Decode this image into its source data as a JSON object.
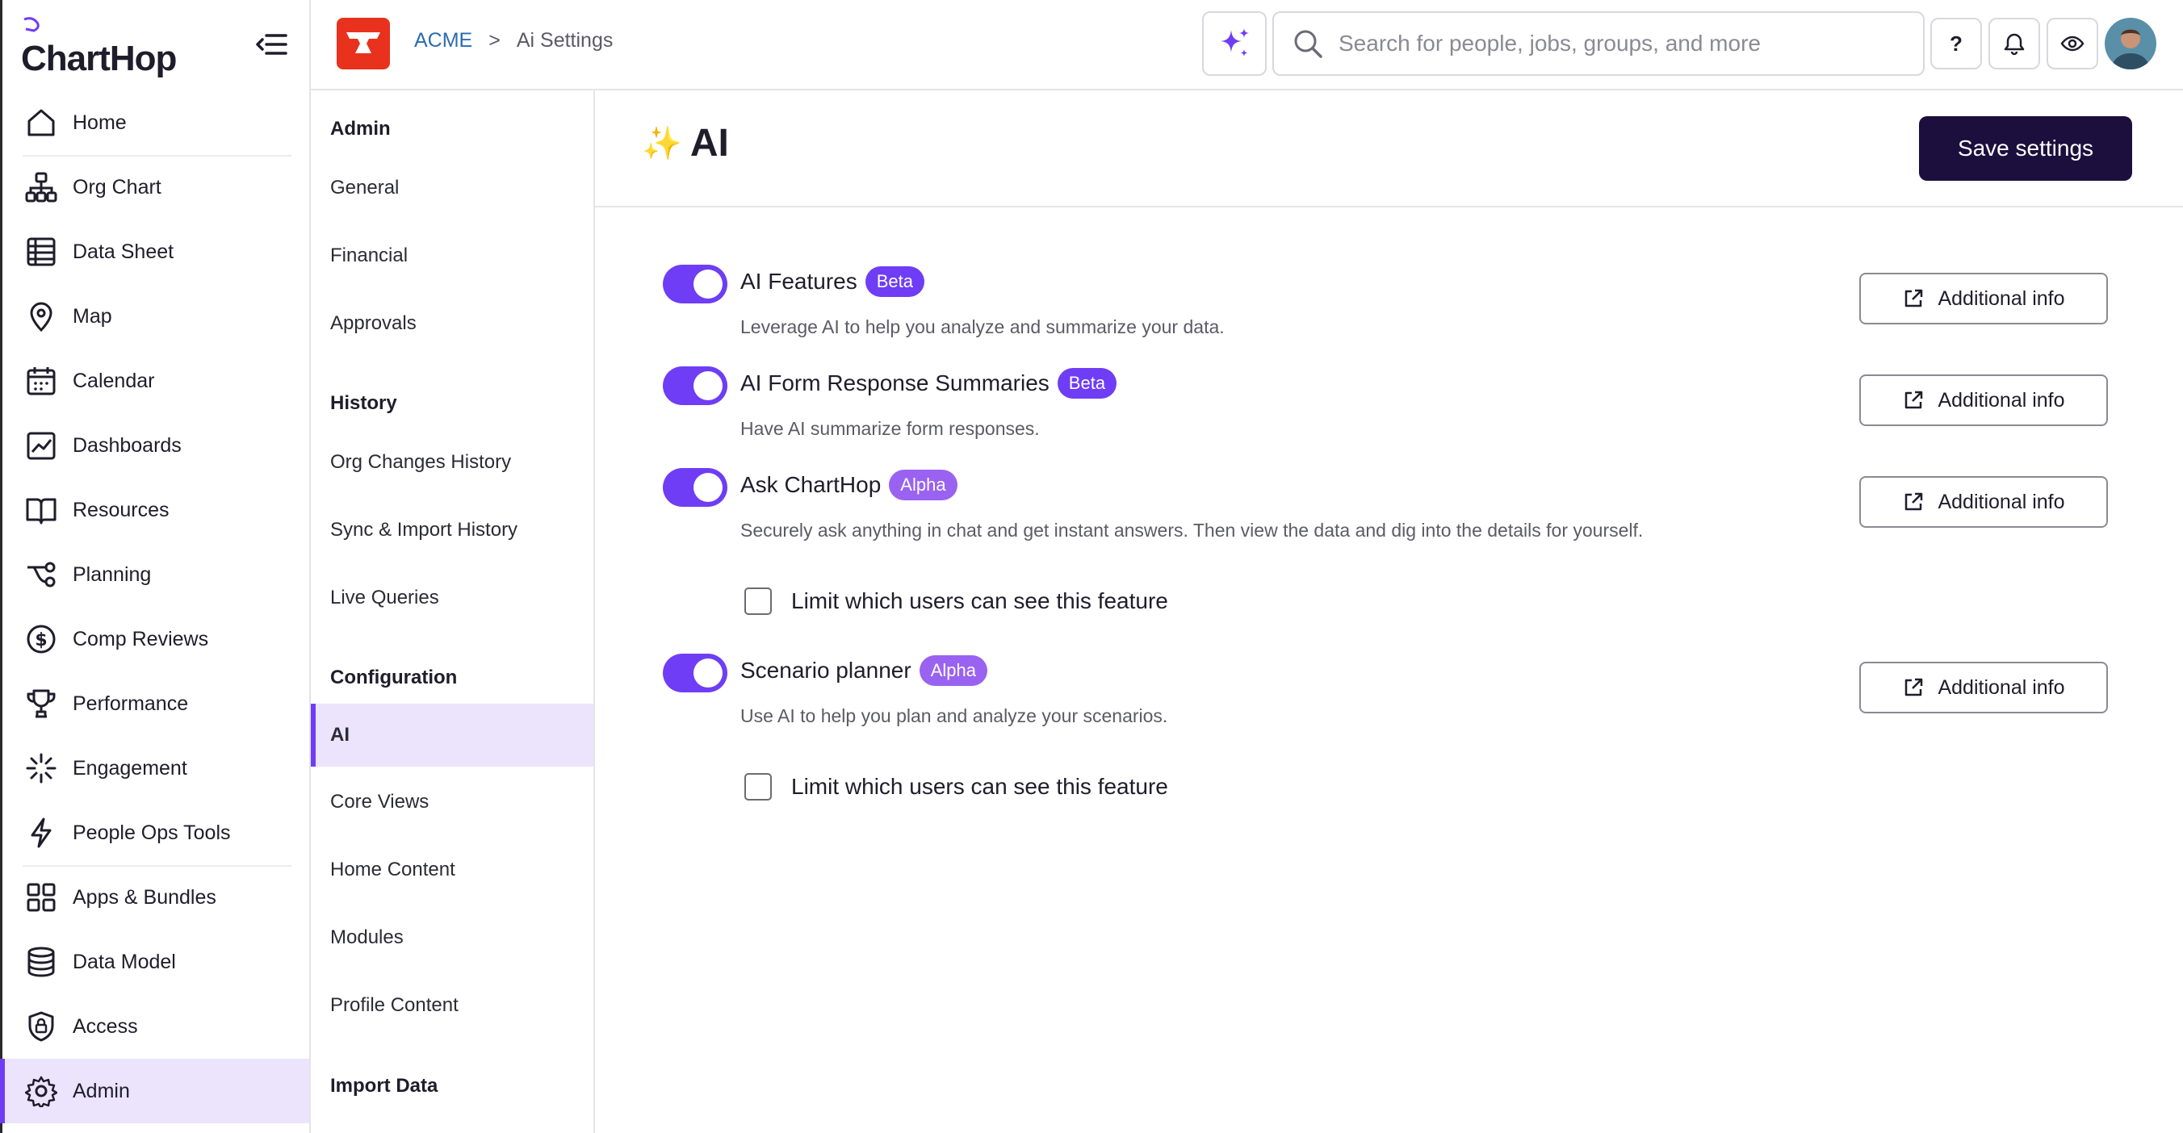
{
  "brand": {
    "name": "ChartHop",
    "accent": "#6f3df5",
    "dark": "#1c0f3d"
  },
  "nav": {
    "items": [
      {
        "label": "Home",
        "icon": "home-icon"
      },
      {
        "label": "Org Chart",
        "icon": "org-chart-icon"
      },
      {
        "label": "Data Sheet",
        "icon": "data-sheet-icon"
      },
      {
        "label": "Map",
        "icon": "map-pin-icon"
      },
      {
        "label": "Calendar",
        "icon": "calendar-icon"
      },
      {
        "label": "Dashboards",
        "icon": "dashboard-icon"
      },
      {
        "label": "Resources",
        "icon": "book-icon"
      },
      {
        "label": "Planning",
        "icon": "planning-icon"
      },
      {
        "label": "Comp Reviews",
        "icon": "dollar-icon"
      },
      {
        "label": "Performance",
        "icon": "trophy-icon"
      },
      {
        "label": "Engagement",
        "icon": "engagement-icon"
      },
      {
        "label": "People Ops Tools",
        "icon": "lightning-icon"
      },
      {
        "label": "Apps & Bundles",
        "icon": "apps-icon"
      },
      {
        "label": "Data Model",
        "icon": "database-icon"
      },
      {
        "label": "Access",
        "icon": "shield-lock-icon"
      },
      {
        "label": "Admin",
        "icon": "gear-icon"
      }
    ]
  },
  "topbar": {
    "breadcrumb": {
      "org": "ACME",
      "separator": ">",
      "page": "Ai Settings"
    },
    "search_placeholder": "Search for people, jobs, groups, and more",
    "help_label": "?"
  },
  "subnav": {
    "sections": [
      {
        "title": "Admin",
        "items": [
          "General",
          "Financial",
          "Approvals"
        ]
      },
      {
        "title": "History",
        "items": [
          "Org Changes History",
          "Sync & Import History",
          "Live Queries"
        ]
      },
      {
        "title": "Configuration",
        "items": [
          "AI",
          "Core Views",
          "Home Content",
          "Modules",
          "Profile Content"
        ]
      },
      {
        "title": "Import Data",
        "items": []
      }
    ],
    "active": "AI"
  },
  "main": {
    "title_emoji": "✨",
    "title": "AI",
    "save_label": "Save settings",
    "info_label": "Additional info",
    "limit_label": "Limit which users can see this feature",
    "features": [
      {
        "title": "AI Features",
        "badge": "Beta",
        "desc": "Leverage AI to help you analyze and summarize your data.",
        "enabled": true
      },
      {
        "title": "AI Form Response Summaries",
        "badge": "Beta",
        "desc": "Have AI summarize form responses.",
        "enabled": true
      },
      {
        "title": "Ask ChartHop",
        "badge": "Alpha",
        "desc": "Securely ask anything in chat and get instant answers. Then view the data and dig into the details for yourself.",
        "enabled": true
      },
      {
        "title": "Scenario planner",
        "badge": "Alpha",
        "desc": "Use AI to help you plan and analyze your scenarios.",
        "enabled": true
      }
    ]
  }
}
